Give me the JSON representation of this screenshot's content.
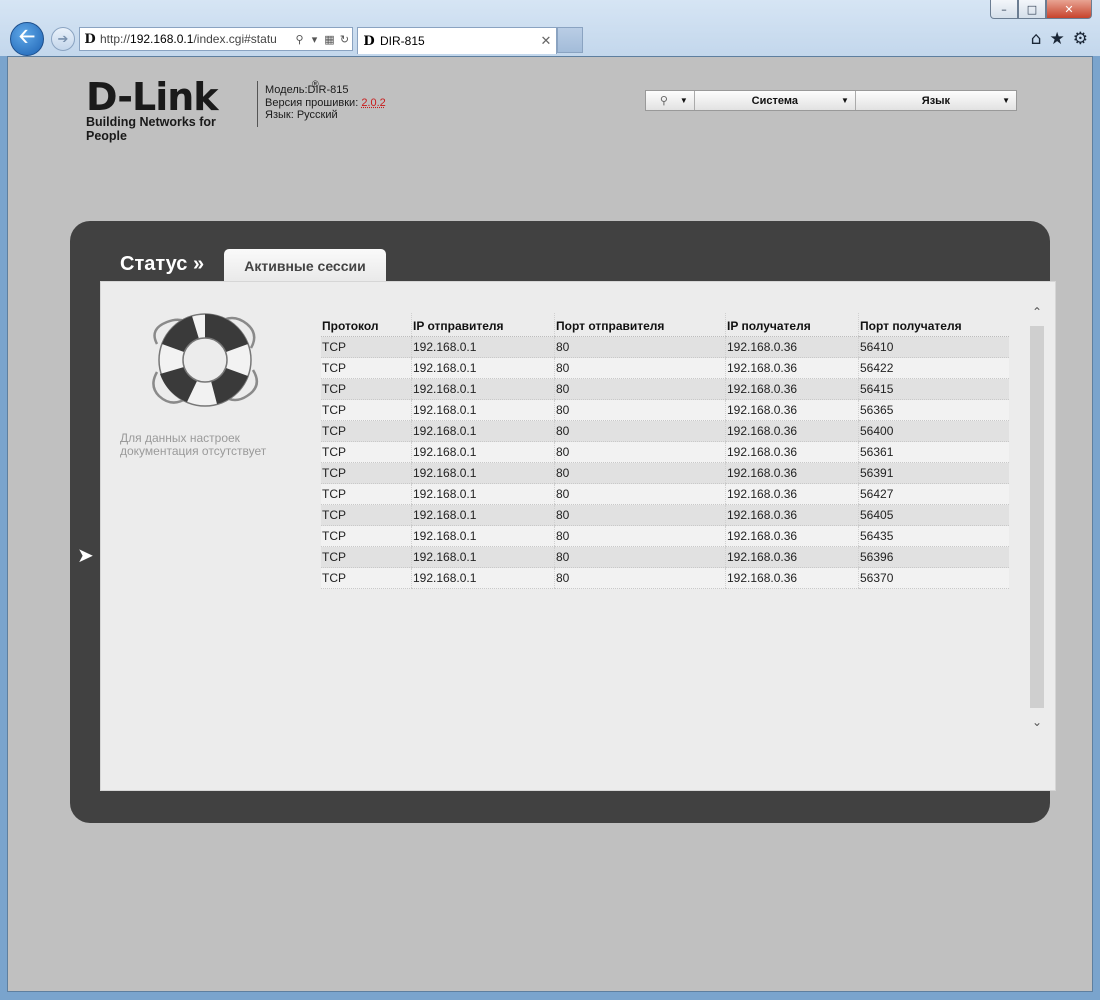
{
  "browser": {
    "url_prefix": "http://",
    "url_host": "192.168.0.1",
    "url_path": "/index.cgi#statu",
    "tab_title": "DIR-815",
    "favicon_letter": "D"
  },
  "header": {
    "logo_text": "D-Link",
    "logo_tagline": "Building Networks for People",
    "model_label": "Модель:DIR-815",
    "firmware_label": "Версия прошивки:",
    "firmware_value": "2.0.2",
    "language_label": "Язык: Русский"
  },
  "topmenu": {
    "system": "Система",
    "language": "Язык"
  },
  "page": {
    "breadcrumb": "Статус »",
    "active_tab": "Активные сессии",
    "no_doc_line1": "Для данных настроек",
    "no_doc_line2": "документация отсутствует"
  },
  "table": {
    "headers": [
      "Протокол",
      "IP отправителя",
      "Порт отправителя",
      "IP получателя",
      "Порт получателя"
    ],
    "rows": [
      [
        "TCP",
        "192.168.0.1",
        "80",
        "192.168.0.36",
        "56410"
      ],
      [
        "TCP",
        "192.168.0.1",
        "80",
        "192.168.0.36",
        "56422"
      ],
      [
        "TCP",
        "192.168.0.1",
        "80",
        "192.168.0.36",
        "56415"
      ],
      [
        "TCP",
        "192.168.0.1",
        "80",
        "192.168.0.36",
        "56365"
      ],
      [
        "TCP",
        "192.168.0.1",
        "80",
        "192.168.0.36",
        "56400"
      ],
      [
        "TCP",
        "192.168.0.1",
        "80",
        "192.168.0.36",
        "56361"
      ],
      [
        "TCP",
        "192.168.0.1",
        "80",
        "192.168.0.36",
        "56391"
      ],
      [
        "TCP",
        "192.168.0.1",
        "80",
        "192.168.0.36",
        "56427"
      ],
      [
        "TCP",
        "192.168.0.1",
        "80",
        "192.168.0.36",
        "56405"
      ],
      [
        "TCP",
        "192.168.0.1",
        "80",
        "192.168.0.36",
        "56435"
      ],
      [
        "TCP",
        "192.168.0.1",
        "80",
        "192.168.0.36",
        "56396"
      ],
      [
        "TCP",
        "192.168.0.1",
        "80",
        "192.168.0.36",
        "56370"
      ]
    ]
  },
  "icons": {
    "help": "lightbulb-icon",
    "lifebuoy": "lifebuoy-icon",
    "back": "back-arrow-icon"
  }
}
